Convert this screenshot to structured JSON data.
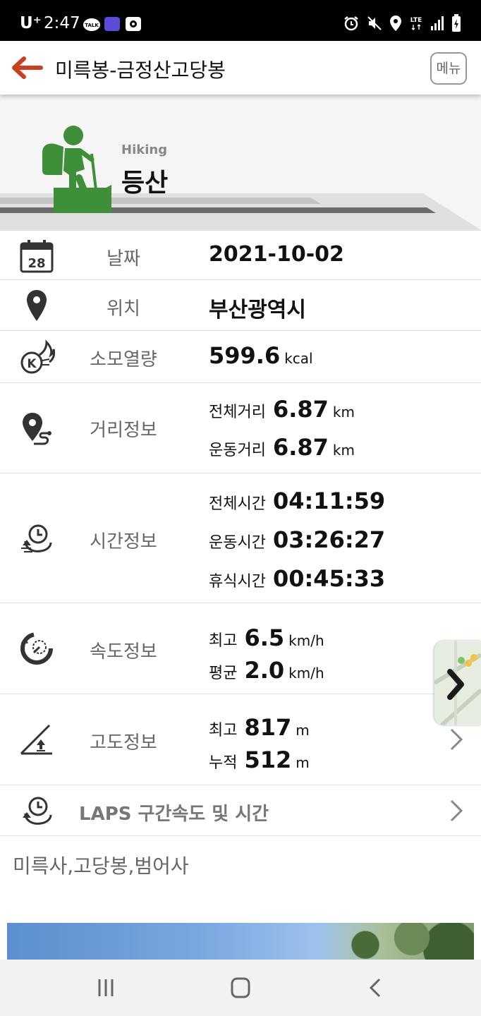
{
  "status_bar": {
    "carrier": "U⁺",
    "time": "2:47",
    "notification_icons": [
      "talk-icon",
      "chat-icon",
      "app-icon"
    ],
    "right_icons": [
      "alarm-icon",
      "mute-vibrate-icon",
      "location-icon",
      "lte-icon",
      "signal-icon",
      "battery-charging-icon"
    ]
  },
  "app_bar": {
    "title": "미륵봉-금정산고당봉",
    "menu_label": "메뉴"
  },
  "hero": {
    "subtitle": "Hiking",
    "title": "등산",
    "icon": "hiker-icon"
  },
  "rows": {
    "date": {
      "label": "날짜",
      "value": "2021-10-02",
      "icon": "calendar-icon",
      "calendar_day": "28"
    },
    "location": {
      "label": "위치",
      "value": "부산광역시",
      "icon": "location-pin-icon"
    },
    "calories": {
      "label": "소모열량",
      "value": "599.6",
      "unit": "kcal",
      "icon": "calorie-icon"
    },
    "distance": {
      "label": "거리정보",
      "icon": "route-icon",
      "total": {
        "key": "전체거리",
        "value": "6.87",
        "unit": "km"
      },
      "moving": {
        "key": "운동거리",
        "value": "6.87",
        "unit": "km"
      }
    },
    "time": {
      "label": "시간정보",
      "icon": "clock-icon",
      "total": {
        "key": "전체시간",
        "value": "04:11:59"
      },
      "moving": {
        "key": "운동시간",
        "value": "03:26:27"
      },
      "rest": {
        "key": "휴식시간",
        "value": "00:45:33"
      }
    },
    "speed": {
      "label": "속도정보",
      "icon": "speedometer-icon",
      "max": {
        "key": "최고",
        "value": "6.5",
        "unit": "km/h"
      },
      "avg": {
        "key": "평균",
        "value": "2.0",
        "unit": "km/h"
      }
    },
    "altitude": {
      "label": "고도정보",
      "icon": "altitude-icon",
      "max": {
        "key": "최고",
        "value": "817",
        "unit": "m"
      },
      "cumulative": {
        "key": "누적",
        "value": "512",
        "unit": "m"
      }
    },
    "laps": {
      "label": "LAPS 구간속도 및 시간",
      "icon": "laps-clock-icon"
    }
  },
  "memo": "미륵사,고당봉,범어사",
  "colors": {
    "accent": "#c8401c",
    "hiker_green": "#3f8f3a",
    "label_gray": "#666666"
  }
}
